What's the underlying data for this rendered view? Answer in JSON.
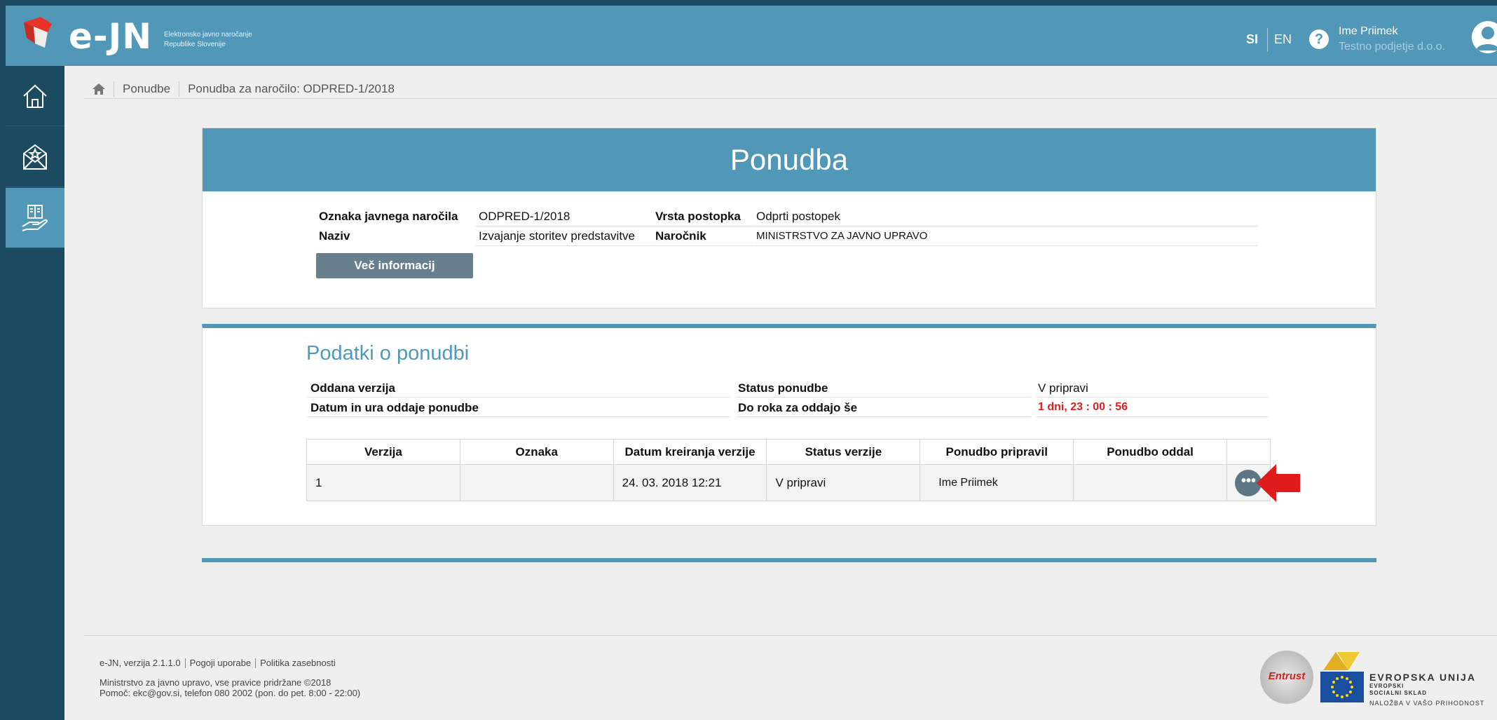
{
  "header": {
    "logo_text": "e-JN",
    "logo_sub_line1": "Elektronsko javno naročanje",
    "logo_sub_line2": "Republike Slovenije",
    "lang_si": "SI",
    "lang_en": "EN",
    "help_label": "?",
    "user_name": "Ime Priimek",
    "user_company": "Testno podjetje d.o.o."
  },
  "breadcrumb": {
    "item1": "Ponudbe",
    "item2": "Ponudba za naročilo: ODPRED-1/2018"
  },
  "tender": {
    "title": "Ponudba",
    "label_oznaka": "Oznaka javnega naročila",
    "value_oznaka": "ODPRED-1/2018",
    "label_vrsta": "Vrsta postopka",
    "value_vrsta": "Odprti postopek",
    "label_naziv": "Naziv",
    "value_naziv": "Izvajanje storitev predstavitve",
    "label_narocnik": "Naročnik",
    "value_narocnik": "MINISTRSTVO ZA JAVNO UPRAVO",
    "more_button": "Več informacij"
  },
  "offer": {
    "section_title": "Podatki o ponudbi",
    "label_oddana": "Oddana verzija",
    "value_oddana": "",
    "label_status": "Status ponudbe",
    "value_status": "V pripravi",
    "label_datum": "Datum in ura oddaje ponudbe",
    "value_datum": "",
    "label_rok": "Do roka za oddajo še",
    "value_rok": "1 dni, 23 : 00 : 56",
    "deadline_color": "#e02020"
  },
  "versions": {
    "columns": [
      "Verzija",
      "Oznaka",
      "Datum kreiranja verzije",
      "Status verzije",
      "Ponudbo pripravil",
      "Ponudbo oddal",
      ""
    ],
    "rows": [
      {
        "verzija": "1",
        "oznaka": "",
        "datum": "24. 03. 2018 12:21",
        "status": "V pripravi",
        "pripravil": "Ime Priimek",
        "oddal": "",
        "action": "•••"
      }
    ]
  },
  "footer": {
    "version": "e-JN, verzija 2.1.1.0",
    "terms": "Pogoji uporabe",
    "privacy": "Politika zasebnosti",
    "copyright": "Ministrstvo za javno upravo, vse pravice pridržane ©2018",
    "help": "Pomoč: ekc@gov.si, telefon 080 2002 (pon. do pet. 8:00 - 22:00)",
    "entrust_label": "Entrust",
    "eu_title": "EVROPSKA UNIJA",
    "eu_sub1": "EVROPSKI",
    "eu_sub2": "SOCIALNI SKLAD",
    "eu_sub3": "NALOŽBA V VAŠO PRIHODNOST"
  },
  "colors": {
    "brand_blue": "#5197b8",
    "sidebar_dark": "#1c4a60",
    "arrow_red": "#e01b1b"
  },
  "icons": {
    "sidebar": [
      "home-icon",
      "envelope-star-icon",
      "hand-document-icon"
    ],
    "breadcrumb_home": "home-icon",
    "help": "question-circle-icon",
    "user": "user-avatar-icon"
  }
}
